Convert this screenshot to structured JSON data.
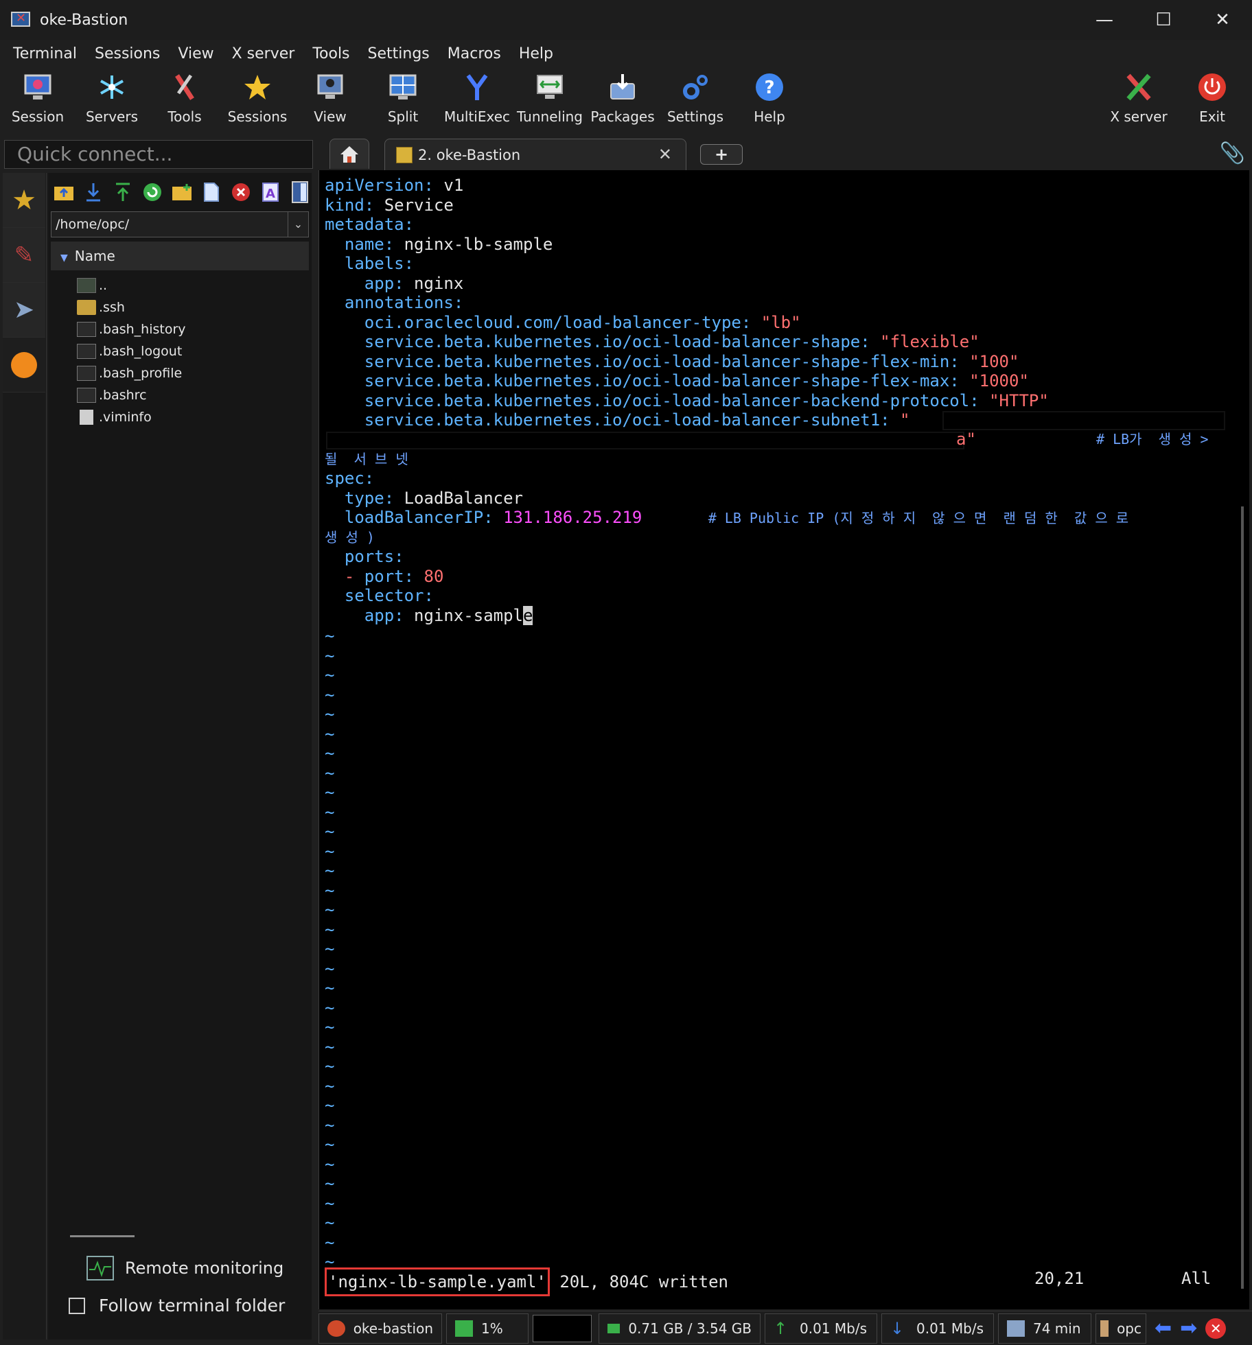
{
  "window": {
    "title": "oke-Bastion"
  },
  "menu": [
    "Terminal",
    "Sessions",
    "View",
    "X server",
    "Tools",
    "Settings",
    "Macros",
    "Help"
  ],
  "toolbar": {
    "buttons": [
      {
        "label": "Session",
        "icon": "session-icon"
      },
      {
        "label": "Servers",
        "icon": "servers-icon"
      },
      {
        "label": "Tools",
        "icon": "tools-icon"
      },
      {
        "label": "Sessions",
        "icon": "star-icon"
      },
      {
        "label": "View",
        "icon": "view-icon"
      },
      {
        "label": "Split",
        "icon": "split-icon"
      },
      {
        "label": "MultiExec",
        "icon": "multiexec-icon"
      },
      {
        "label": "Tunneling",
        "icon": "tunneling-icon"
      },
      {
        "label": "Packages",
        "icon": "packages-icon"
      },
      {
        "label": "Settings",
        "icon": "settings-icon"
      },
      {
        "label": "Help",
        "icon": "help-icon"
      }
    ],
    "xserver_label": "X server",
    "exit_label": "Exit"
  },
  "quick_connect": {
    "placeholder": "Quick connect..."
  },
  "sftp": {
    "path": "/home/opc/",
    "column_name": "Name",
    "files": [
      "..",
      ".ssh",
      ".bash_history",
      ".bash_logout",
      ".bash_profile",
      ".bashrc",
      ".viminfo"
    ],
    "remote_monitoring": "Remote monitoring",
    "follow_terminal_folder": "Follow terminal folder"
  },
  "tabs": {
    "active_label": "2. oke-Bastion"
  },
  "terminal": {
    "l1a": "apiVersion:",
    "l1b": " v1",
    "l2a": "kind:",
    "l2b": " Service",
    "l3a": "metadata:",
    "l4a": "  name:",
    "l4b": " nginx-lb-sample",
    "l5a": "  labels:",
    "l6a": "    app:",
    "l6b": " nginx",
    "l7a": "  annotations:",
    "l8a": "    oci.oraclecloud.com/load-balancer-type:",
    "l8b": " \"lb\"",
    "l9a": "    service.beta.kubernetes.io/oci-load-balancer-shape:",
    "l9b": " \"flexible\"",
    "l10a": "    service.beta.kubernetes.io/oci-load-balancer-shape-flex-min:",
    "l10b": " \"100\"",
    "l11a": "    service.beta.kubernetes.io/oci-load-balancer-shape-flex-max:",
    "l11b": " \"1000\"",
    "l12a": "    service.beta.kubernetes.io/oci-load-balancer-backend-protocol:",
    "l12b": " \"HTTP\"",
    "l13a": "    service.beta.kubernetes.io/oci-load-balancer-subnet1:",
    "l13b": " \"",
    "l14b": "a\"",
    "l14c": "# LB가  생 성 >",
    "l15c": "될  서 브 넷",
    "l16a": "spec:",
    "l17a": "  type:",
    "l17b": " LoadBalancer",
    "l18a": "  loadBalancerIP:",
    "l18b": " 131.186.25.219",
    "l18c": "        # LB Public IP (지 정 하 지  않 으 면  랜 덤 한  값 으 로",
    "l19c": "생 성 )",
    "l20a": "  ports:",
    "l21a": "  -",
    "l21b": " port:",
    "l21c": " 80",
    "l22a": "  selector:",
    "l23a": "    app:",
    "l23b": " nginx-sampl",
    "l23cur": "e",
    "tilde": "~",
    "filename": "'nginx-lb-sample.yaml'",
    "written": " 20L, 804C written",
    "position": "20,21",
    "scroll": "All"
  },
  "statusbar": {
    "session": "oke-bastion",
    "cpu": "1%",
    "memory": "0.71 GB / 3.54 GB",
    "upload": "0.01 Mb/s",
    "download": "0.01 Mb/s",
    "uptime": "74 min",
    "user": "opc"
  }
}
